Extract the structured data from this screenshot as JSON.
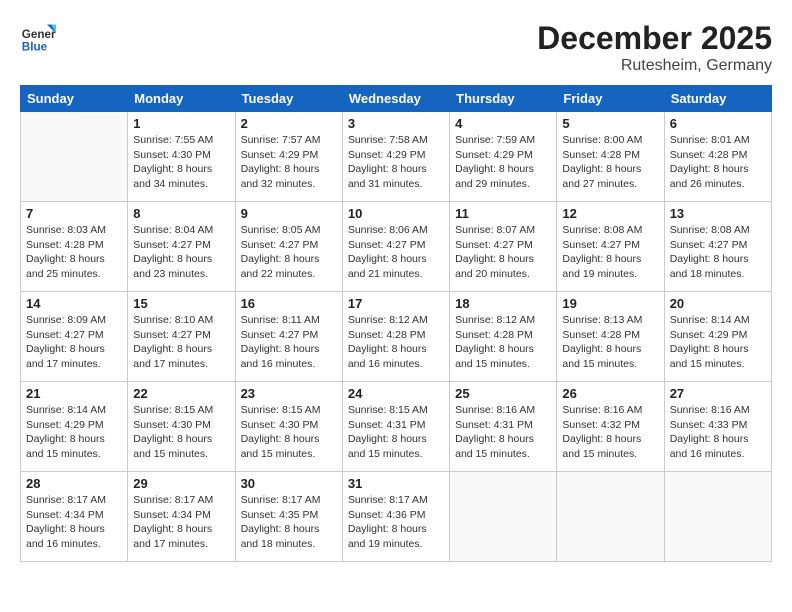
{
  "header": {
    "logo_general": "General",
    "logo_blue": "Blue",
    "month_title": "December 2025",
    "subtitle": "Rutesheim, Germany"
  },
  "weekdays": [
    "Sunday",
    "Monday",
    "Tuesday",
    "Wednesday",
    "Thursday",
    "Friday",
    "Saturday"
  ],
  "weeks": [
    [
      {
        "day": "",
        "info": ""
      },
      {
        "day": "1",
        "info": "Sunrise: 7:55 AM\nSunset: 4:30 PM\nDaylight: 8 hours\nand 34 minutes."
      },
      {
        "day": "2",
        "info": "Sunrise: 7:57 AM\nSunset: 4:29 PM\nDaylight: 8 hours\nand 32 minutes."
      },
      {
        "day": "3",
        "info": "Sunrise: 7:58 AM\nSunset: 4:29 PM\nDaylight: 8 hours\nand 31 minutes."
      },
      {
        "day": "4",
        "info": "Sunrise: 7:59 AM\nSunset: 4:29 PM\nDaylight: 8 hours\nand 29 minutes."
      },
      {
        "day": "5",
        "info": "Sunrise: 8:00 AM\nSunset: 4:28 PM\nDaylight: 8 hours\nand 27 minutes."
      },
      {
        "day": "6",
        "info": "Sunrise: 8:01 AM\nSunset: 4:28 PM\nDaylight: 8 hours\nand 26 minutes."
      }
    ],
    [
      {
        "day": "7",
        "info": "Sunrise: 8:03 AM\nSunset: 4:28 PM\nDaylight: 8 hours\nand 25 minutes."
      },
      {
        "day": "8",
        "info": "Sunrise: 8:04 AM\nSunset: 4:27 PM\nDaylight: 8 hours\nand 23 minutes."
      },
      {
        "day": "9",
        "info": "Sunrise: 8:05 AM\nSunset: 4:27 PM\nDaylight: 8 hours\nand 22 minutes."
      },
      {
        "day": "10",
        "info": "Sunrise: 8:06 AM\nSunset: 4:27 PM\nDaylight: 8 hours\nand 21 minutes."
      },
      {
        "day": "11",
        "info": "Sunrise: 8:07 AM\nSunset: 4:27 PM\nDaylight: 8 hours\nand 20 minutes."
      },
      {
        "day": "12",
        "info": "Sunrise: 8:08 AM\nSunset: 4:27 PM\nDaylight: 8 hours\nand 19 minutes."
      },
      {
        "day": "13",
        "info": "Sunrise: 8:08 AM\nSunset: 4:27 PM\nDaylight: 8 hours\nand 18 minutes."
      }
    ],
    [
      {
        "day": "14",
        "info": "Sunrise: 8:09 AM\nSunset: 4:27 PM\nDaylight: 8 hours\nand 17 minutes."
      },
      {
        "day": "15",
        "info": "Sunrise: 8:10 AM\nSunset: 4:27 PM\nDaylight: 8 hours\nand 17 minutes."
      },
      {
        "day": "16",
        "info": "Sunrise: 8:11 AM\nSunset: 4:27 PM\nDaylight: 8 hours\nand 16 minutes."
      },
      {
        "day": "17",
        "info": "Sunrise: 8:12 AM\nSunset: 4:28 PM\nDaylight: 8 hours\nand 16 minutes."
      },
      {
        "day": "18",
        "info": "Sunrise: 8:12 AM\nSunset: 4:28 PM\nDaylight: 8 hours\nand 15 minutes."
      },
      {
        "day": "19",
        "info": "Sunrise: 8:13 AM\nSunset: 4:28 PM\nDaylight: 8 hours\nand 15 minutes."
      },
      {
        "day": "20",
        "info": "Sunrise: 8:14 AM\nSunset: 4:29 PM\nDaylight: 8 hours\nand 15 minutes."
      }
    ],
    [
      {
        "day": "21",
        "info": "Sunrise: 8:14 AM\nSunset: 4:29 PM\nDaylight: 8 hours\nand 15 minutes."
      },
      {
        "day": "22",
        "info": "Sunrise: 8:15 AM\nSunset: 4:30 PM\nDaylight: 8 hours\nand 15 minutes."
      },
      {
        "day": "23",
        "info": "Sunrise: 8:15 AM\nSunset: 4:30 PM\nDaylight: 8 hours\nand 15 minutes."
      },
      {
        "day": "24",
        "info": "Sunrise: 8:15 AM\nSunset: 4:31 PM\nDaylight: 8 hours\nand 15 minutes."
      },
      {
        "day": "25",
        "info": "Sunrise: 8:16 AM\nSunset: 4:31 PM\nDaylight: 8 hours\nand 15 minutes."
      },
      {
        "day": "26",
        "info": "Sunrise: 8:16 AM\nSunset: 4:32 PM\nDaylight: 8 hours\nand 15 minutes."
      },
      {
        "day": "27",
        "info": "Sunrise: 8:16 AM\nSunset: 4:33 PM\nDaylight: 8 hours\nand 16 minutes."
      }
    ],
    [
      {
        "day": "28",
        "info": "Sunrise: 8:17 AM\nSunset: 4:34 PM\nDaylight: 8 hours\nand 16 minutes."
      },
      {
        "day": "29",
        "info": "Sunrise: 8:17 AM\nSunset: 4:34 PM\nDaylight: 8 hours\nand 17 minutes."
      },
      {
        "day": "30",
        "info": "Sunrise: 8:17 AM\nSunset: 4:35 PM\nDaylight: 8 hours\nand 18 minutes."
      },
      {
        "day": "31",
        "info": "Sunrise: 8:17 AM\nSunset: 4:36 PM\nDaylight: 8 hours\nand 19 minutes."
      },
      {
        "day": "",
        "info": ""
      },
      {
        "day": "",
        "info": ""
      },
      {
        "day": "",
        "info": ""
      }
    ]
  ]
}
